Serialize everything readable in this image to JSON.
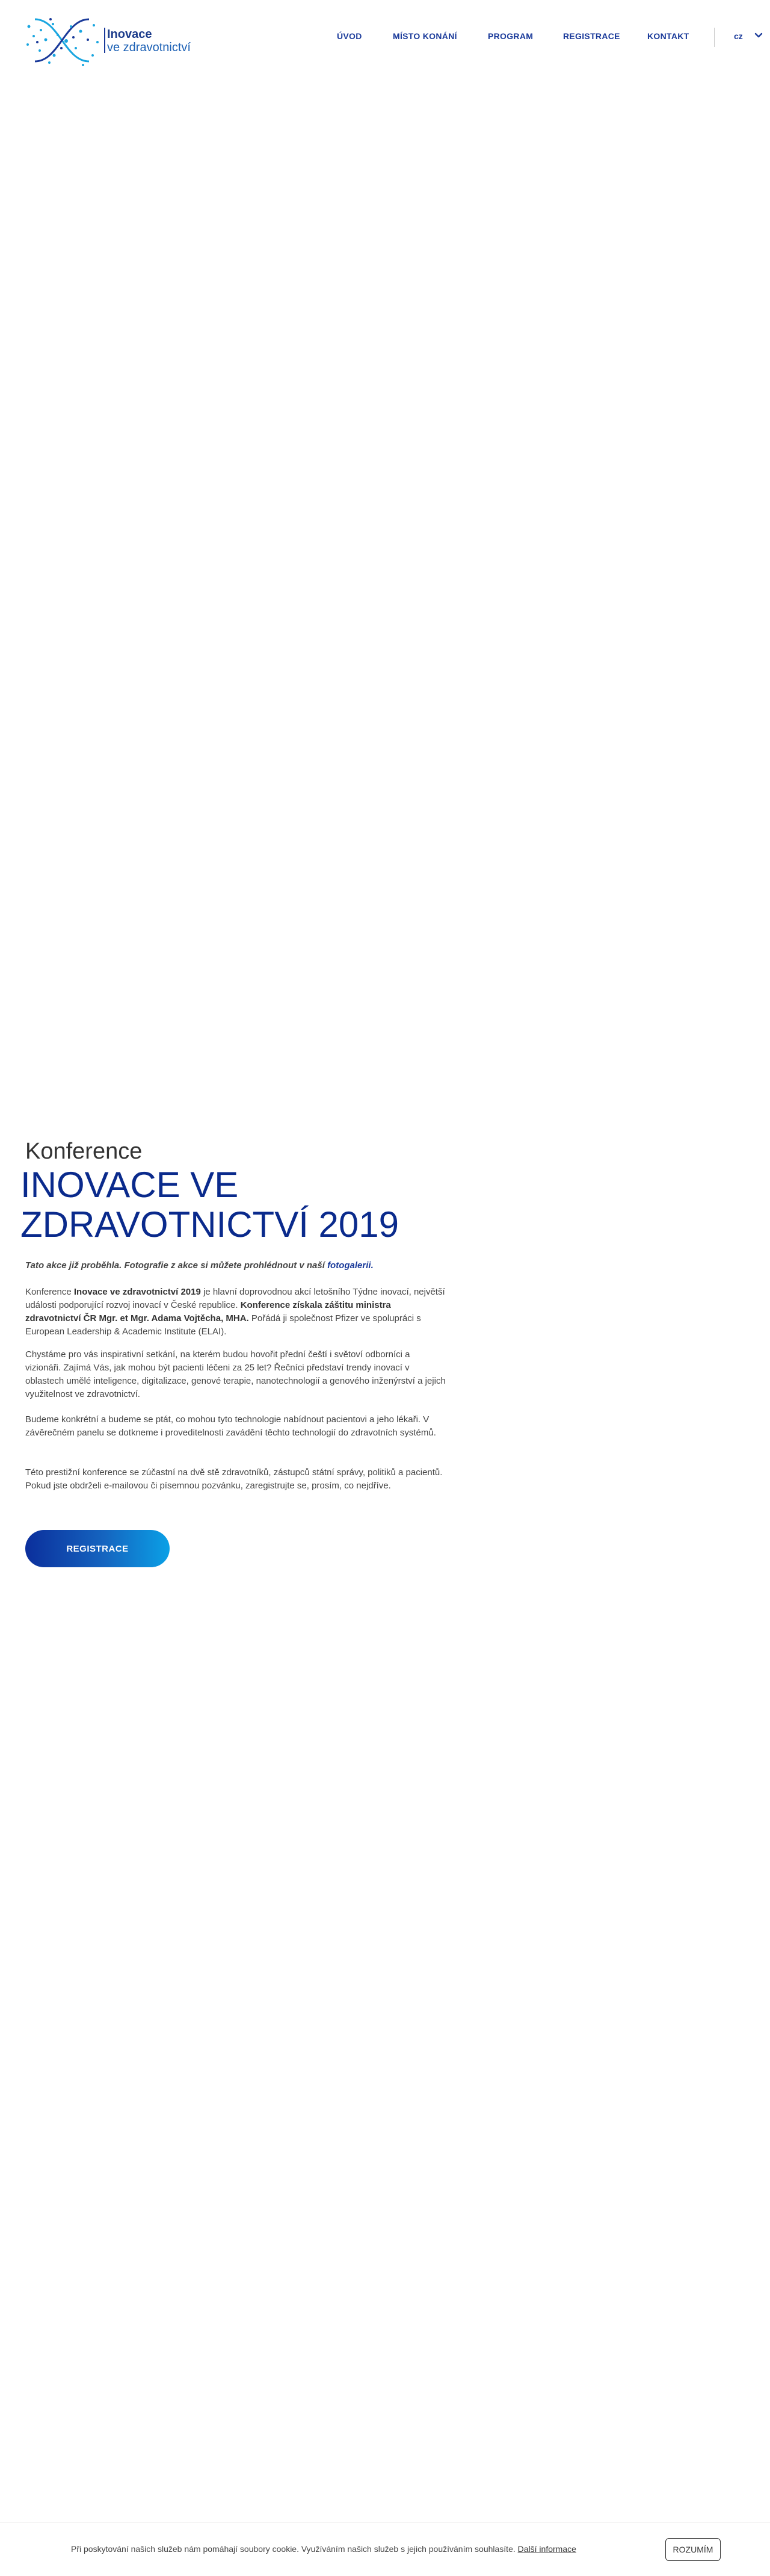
{
  "header": {
    "logo_line1": "Inovace",
    "logo_line2": "ve zdravotnictví",
    "nav": [
      {
        "label": "ÚVOD"
      },
      {
        "label": "MÍSTO KONÁNÍ"
      },
      {
        "label": "PROGRAM"
      },
      {
        "label": "REGISTRACE"
      },
      {
        "label": "KONTAKT"
      }
    ],
    "lang": "cz"
  },
  "main": {
    "kicker": "Konference",
    "title": "INOVACE VE ZDRAVOTNICTVÍ 2019",
    "notice_text": "Tato akce již proběhla. Fotografie z akce si můžete prohlédnout v naší ",
    "notice_link": "fotogalerii.",
    "p1": {
      "a": "Konference ",
      "b": "Inovace ve zdravotnictví 2019",
      "c": " je hlavní doprovodnou akcí letošního Týdne inovací, největší události podporující rozvoj inovací v České republice. ",
      "d": "Konference získala záštitu ministra zdravotnictví ČR Mgr. et Mgr. Adama Vojtěcha, MHA.",
      "e": " Pořádá ji společnost Pfizer ve spolupráci s European Leadership & Academic Institute (ELAI)."
    },
    "p2": "Chystáme pro vás inspirativní setkání, na kterém budou hovořit přední čeští i světoví odborníci a vizionáři. Zajímá Vás, jak mohou být pacienti léčeni za 25 let? Řečníci představí trendy inovací v oblastech umělé inteligence, digitalizace, genové terapie, nanotechnologií a genového inženýrství a jejich využitelnost ve zdravotnictví.",
    "p3": "Budeme konkrétní a budeme se ptát, co mohou tyto technologie nabídnout pacientovi a jeho lékaři. V závěrečném panelu se dotkneme i proveditelnosti zavádění těchto technologií do zdravotních systémů.",
    "p4": "Této prestižní konference se zúčastní na dvě stě zdravotníků, zástupců státní správy, politiků a pacientů. Pokud jste obdrželi e-mailovou či písemnou pozvánku, zaregistrujte se, prosím, co nejdříve.",
    "register_label": "REGISTRACE"
  },
  "cookie": {
    "text": "Při poskytování našich služeb nám pomáhají soubory cookie. Využíváním našich služeb s jejich používáním souhlasíte. ",
    "link": "Další informace",
    "button": "ROZUMÍM"
  },
  "colors": {
    "brand_navy": "#0a2a8c",
    "nav_blue": "#1a3a9a",
    "accent_cyan": "#0aa0e6"
  }
}
